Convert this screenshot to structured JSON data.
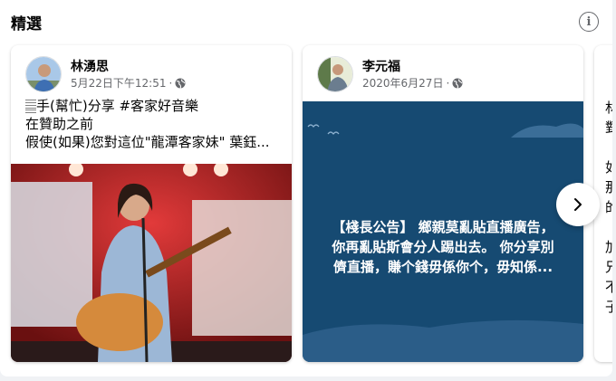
{
  "section": {
    "title": "精選"
  },
  "posts": [
    {
      "author": "林湧思",
      "date": "5月22日下午12:51",
      "separator": "·",
      "privacy_icon": "globe-icon",
      "lines": [
        "𝄛手(幫忙)分享 #客家好音樂",
        "在贊助之前",
        "假使(如果)您對這位\"龍潭客家妹\" 葉鈺..."
      ]
    },
    {
      "author": "李元福",
      "date": "2020年6月27日",
      "separator": "·",
      "privacy_icon": "globe-icon",
      "lines": [
        "【棧長公告】 鄉親莫亂貼直播廣告，",
        "你再亂貼斯會分人踢出去。 你分享別",
        "儕直播，賺个錢毋係你个，毋知係..."
      ]
    }
  ],
  "peek_card": {
    "chars": [
      "林",
      "對",
      "",
      "如",
      "那",
      "的",
      "",
      "加",
      "兄",
      "不",
      "子"
    ]
  },
  "colors": {
    "panel_bg": "#ffffff",
    "page_bg": "#f0f2f5",
    "blue_card": "#164a72",
    "muted_text": "#65676b"
  }
}
